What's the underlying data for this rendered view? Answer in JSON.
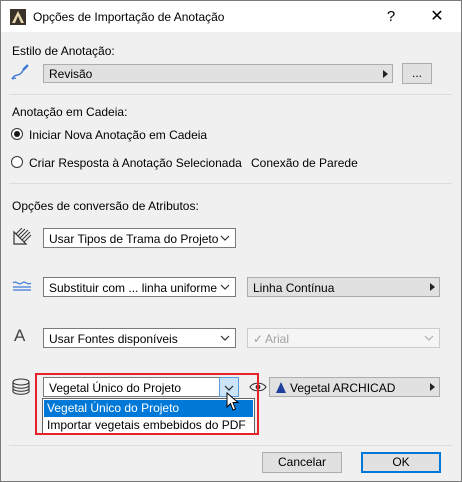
{
  "window": {
    "title": "Opções de Importação de Anotação",
    "help_glyph": "?",
    "close_glyph": "✕"
  },
  "style_section": {
    "label": "Estilo de Anotação:",
    "value": "Revisão",
    "more_button": "..."
  },
  "chain_section": {
    "label": "Anotação em Cadeia:",
    "options": [
      {
        "label": "Iniciar Nova Anotação em Cadeia",
        "selected": true
      },
      {
        "label": "Criar Resposta à Anotação Selecionada",
        "selected": false
      }
    ],
    "extra_label": "Conexão de Parede"
  },
  "attributes_section": {
    "label": "Opções de conversão de Atributos:",
    "fill": {
      "value": "Usar Tipos de Trama do Projeto",
      "icon": "fill-pattern-icon"
    },
    "line": {
      "value": "Substituir com ... linha uniforme",
      "secondary_value": "Linha Contínua",
      "icon": "line-type-icon"
    },
    "font": {
      "value": "Usar Fontes disponíveis",
      "secondary_value": "Arial",
      "secondary_check": "✓",
      "icon": "font-icon"
    },
    "vegetation": {
      "value": "Vegetal Único do Projeto",
      "secondary_value": "Vegetal ARCHICAD",
      "icon": "surface-layers-icon",
      "options": [
        "Vegetal Único do Projeto",
        "Importar vegetais embebidos do PDF"
      ],
      "highlighted_index": 0
    }
  },
  "footer": {
    "cancel_label": "Cancelar",
    "ok_label": "OK"
  },
  "colors": {
    "accent": "#0078d7",
    "highlight_border": "#e8202a"
  }
}
